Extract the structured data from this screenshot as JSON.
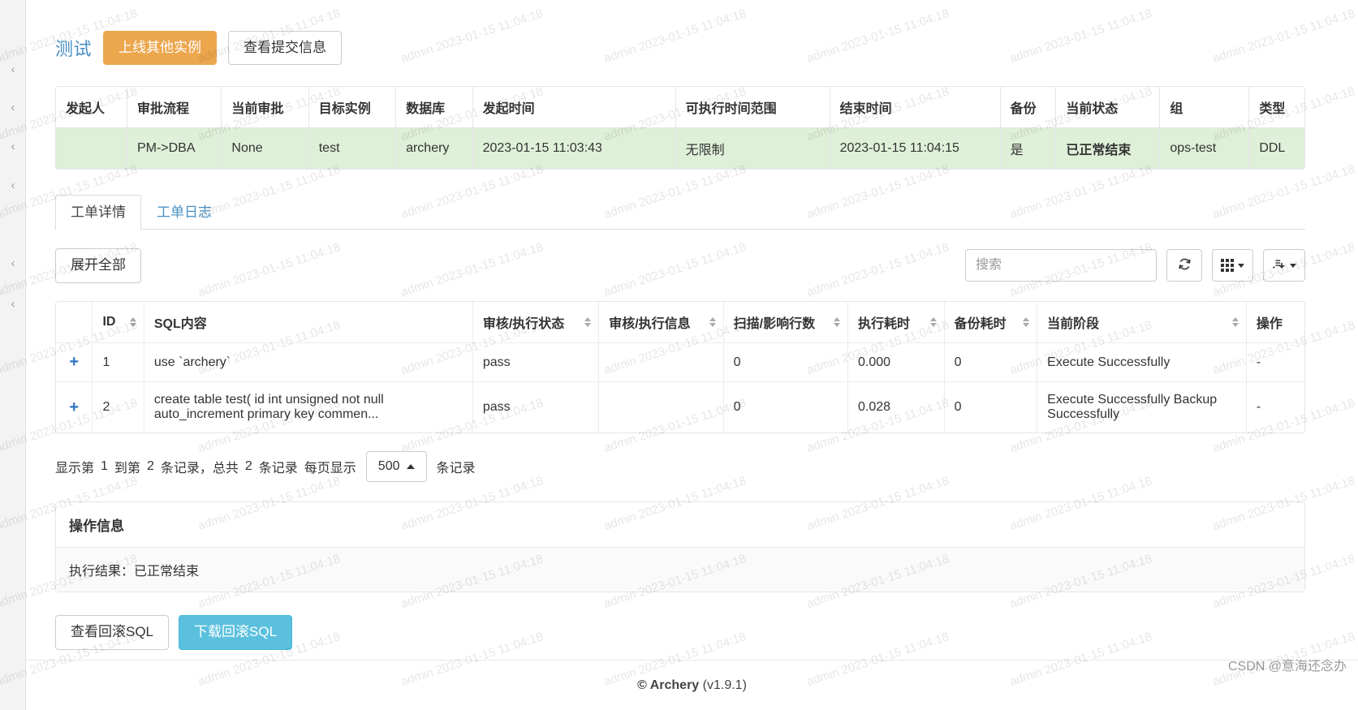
{
  "header": {
    "title": "测试",
    "primary_action": "上线其他实例",
    "secondary_action": "查看提交信息"
  },
  "info_table": {
    "columns": [
      "发起人",
      "审批流程",
      "当前审批",
      "目标实例",
      "数据库",
      "发起时间",
      "可执行时间范围",
      "结束时间",
      "备份",
      "当前状态",
      "组",
      "类型"
    ],
    "row": {
      "initiator": "",
      "workflow": "PM->DBA",
      "current_approver": "None",
      "instance": "test",
      "database": "archery",
      "start_time": "2023-01-15 11:03:43",
      "exec_window": "无限制",
      "end_time": "2023-01-15 11:04:15",
      "backup": "是",
      "status": "已正常结束",
      "group": "ops-test",
      "type": "DDL"
    }
  },
  "tabs": [
    {
      "label": "工单详情",
      "active": true
    },
    {
      "label": "工单日志",
      "active": false
    }
  ],
  "toolbar": {
    "expand_all": "展开全部",
    "search_placeholder": "搜索",
    "search_value": "",
    "refresh_icon": "refresh-icon",
    "columns_icon": "grid-columns-icon",
    "export_icon": "export-icon"
  },
  "sql_table": {
    "columns": [
      {
        "label": "",
        "sortable": false
      },
      {
        "label": "ID",
        "sortable": true
      },
      {
        "label": "SQL内容",
        "sortable": false
      },
      {
        "label": "审核/执行状态",
        "sortable": true
      },
      {
        "label": "审核/执行信息",
        "sortable": true
      },
      {
        "label": "扫描/影响行数",
        "sortable": true
      },
      {
        "label": "执行耗时",
        "sortable": true
      },
      {
        "label": "备份耗时",
        "sortable": true
      },
      {
        "label": "当前阶段",
        "sortable": true
      },
      {
        "label": "操作",
        "sortable": false
      }
    ],
    "rows": [
      {
        "expand": "+",
        "id": "1",
        "sql": "use `archery`",
        "state": "pass",
        "message": "",
        "rows_affected": "0",
        "exec_cost": "0.000",
        "backup_cost": "0",
        "stage": "Execute Successfully",
        "op": "-"
      },
      {
        "expand": "+",
        "id": "2",
        "sql": "create table test( id int unsigned not null auto_increment primary key commen...",
        "state": "pass",
        "message": "",
        "rows_affected": "0",
        "exec_cost": "0.028",
        "backup_cost": "0",
        "stage": "Execute Successfully Backup Successfully",
        "op": "-"
      }
    ]
  },
  "pagination": {
    "prefix": "显示第",
    "from": "1",
    "middle": "到第",
    "to": "2",
    "records_label": "条记录，总共",
    "total": "2",
    "records_label2": "条记录",
    "per_page_label": "每页显示",
    "page_size": "500",
    "suffix": "条记录"
  },
  "operation_panel": {
    "title": "操作信息",
    "body": "执行结果：已正常结束"
  },
  "bottom_buttons": {
    "view_rollback": "查看回滚SQL",
    "download_rollback": "下载回滚SQL"
  },
  "footer": {
    "copyright": "© Archery",
    "version": "(v1.9.1)"
  },
  "watermark": {
    "text": "admin 2023-01-15 11:04:18"
  },
  "csdn_mark": "CSDN @意海还念办",
  "colors": {
    "accent_blue": "#4a90c4",
    "warning": "#eca64c",
    "info": "#5bc0de",
    "success_bg": "#dff0d8",
    "success_text": "#1f9c2f"
  }
}
